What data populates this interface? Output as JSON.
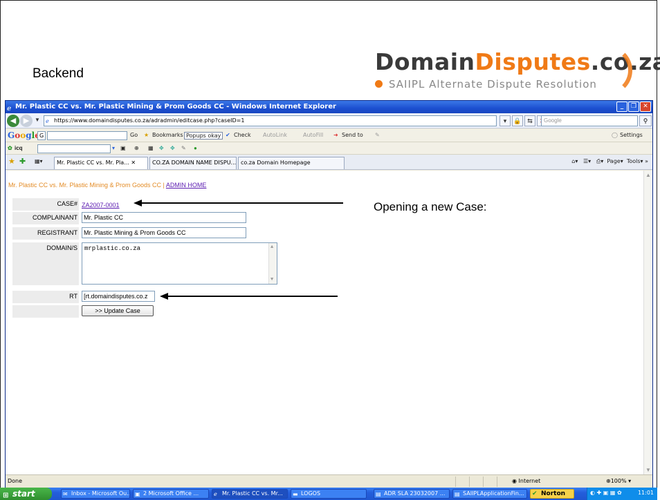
{
  "slide": {
    "title": "Backend",
    "logo": {
      "part1": "Domain",
      "part2": "Disputes",
      "part3": ".co.za",
      "subtitle": "SAIIPL Alternate Dispute Resolution",
      "accent_color": "#f07a16"
    },
    "annotation": "Opening a new Case:"
  },
  "browser": {
    "window_title": "Mr. Plastic CC vs. Mr. Plastic Mining & Prom Goods CC - Windows Internet Explorer",
    "url": "https://www.domaindisputes.co.za/adradmin/editcase.php?caseID=1",
    "search_placeholder": "Google",
    "google_toolbar": {
      "go": "Go",
      "bookmarks": "Bookmarks",
      "popups": "Popups okay",
      "check": "Check",
      "autolink": "AutoLink",
      "autofill": "AutoFill",
      "send_to": "Send to",
      "settings": "Settings"
    },
    "icq_label": "icq",
    "tabs": [
      {
        "label": "Mr. Plastic CC vs. Mr. Pla..."
      },
      {
        "label": "CO.ZA DOMAIN NAME DISPU..."
      },
      {
        "label": "co.za Domain Homepage"
      }
    ],
    "command_bar": {
      "page": "Page",
      "tools": "Tools"
    },
    "status": {
      "text": "Done",
      "zone": "Internet",
      "zoom": "100%"
    }
  },
  "page": {
    "breadcrumb_text": "Mr. Plastic CC vs. Mr. Plastic Mining & Prom Goods CC | ",
    "breadcrumb_link": "ADMIN HOME",
    "form": {
      "case_label": "CASE#",
      "case_value": "ZA2007-0001",
      "complainant_label": "COMPLAINANT",
      "complainant_value": "Mr. Plastic CC",
      "registrant_label": "REGISTRANT",
      "registrant_value": "Mr. Plastic Mining & Prom Goods CC",
      "domains_label": "DOMAIN/S",
      "domains_value": "mrplastic.co.za",
      "rt_label": "RT",
      "rt_value": "[rt.domaindisputes.co.z",
      "submit_label": ">> Update Case"
    }
  },
  "taskbar": {
    "start": "start",
    "items": [
      {
        "label": "Inbox - Microsoft Ou..."
      },
      {
        "label": "2 Microsoft Office ..."
      },
      {
        "label": "Mr. Plastic CC vs. Mr..."
      },
      {
        "label": "LOGOS"
      },
      {
        "label": "ADR SLA 23032007 ..."
      },
      {
        "label": "SAIIPLApplicationFin..."
      }
    ],
    "norton": "Norton",
    "time": "11:01"
  }
}
